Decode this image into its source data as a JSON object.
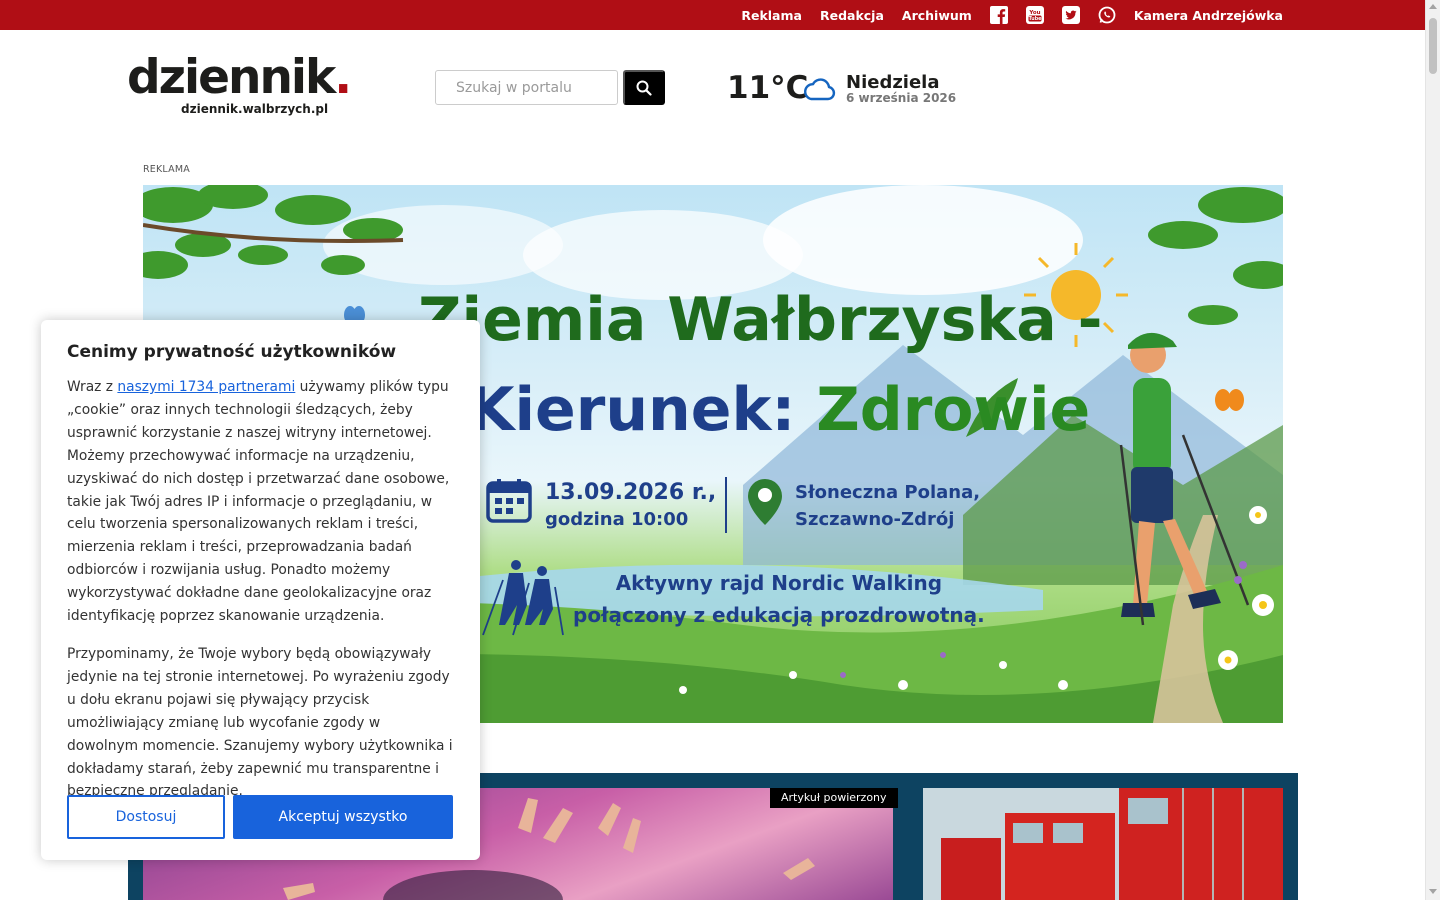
{
  "topnav": {
    "links": [
      "Reklama",
      "Redakcja",
      "Archiwum"
    ],
    "social_icons": [
      "facebook-icon",
      "youtube-icon",
      "twitter-icon",
      "whatsapp-icon"
    ],
    "camera": "Kamera Andrzejówka"
  },
  "header": {
    "logo_text": "dziennik",
    "logo_dot": ".",
    "logo_sub": "dziennik.walbrzych.pl",
    "search_placeholder": "Szukaj w portalu",
    "search_icon": "search-icon"
  },
  "weather": {
    "temperature": "11°C",
    "icon": "cloud-icon",
    "day": "Niedziela",
    "date": "6 września 2026"
  },
  "ad": {
    "label": "REKLAMA",
    "banner": {
      "title_line1": "Ziemia Wałbrzyska -",
      "title_line2_part1": "Kierunek: ",
      "title_line2_part2": "Zdrowie",
      "date_line1": "13.09.2026 r.,",
      "date_line2": "godzina 10:00",
      "place_line1": "Słoneczna Polana,",
      "place_line2": "Szczawno-Zdrój",
      "desc_line1": "Aktywny rajd Nordic Walking",
      "desc_line2": "połączony z edukacją prozdrowotną."
    }
  },
  "articles": {
    "tag": "Artykuł powierzony"
  },
  "cookie": {
    "title": "Cenimy prywatność użytkowników",
    "p1_before": "Wraz z ",
    "p1_link": "naszymi 1734 partnerami",
    "p1_after": " używamy plików typu „cookie” oraz innych technologii śledzących, żeby usprawnić korzystanie z naszej witryny internetowej. Możemy przechowywać informacje na urządzeniu, uzyskiwać do nich dostęp i przetwarzać dane osobowe, takie jak Twój adres IP i informacje o przeglądaniu, w celu tworzenia spersonalizowanych reklam i treści, mierzenia reklam i treści, przeprowadzania badań odbiorców i rozwijania usług. Ponadto możemy wykorzystywać dokładne dane geolokalizacyjne oraz identyfikację poprzez skanowanie urządzenia.",
    "p2": "Przypominamy, że Twoje wybory będą obowiązywały jedynie na tej stronie internetowej. Po wyrażeniu zgody u dołu ekranu pojawi się pływający przycisk umożliwiający zmianę lub wycofanie zgody w dowolnym momencie. Szanujemy wybory użytkownika i dokładamy starań, żeby zapewnić mu transparentne i bezpieczne przeglądanie.",
    "btn_customize": "Dostosuj",
    "btn_accept": "Akceptuj wszystko"
  },
  "colors": {
    "brand_red": "#b00e15",
    "cookie_blue": "#1863dc",
    "strip_navy": "#0d4361"
  }
}
